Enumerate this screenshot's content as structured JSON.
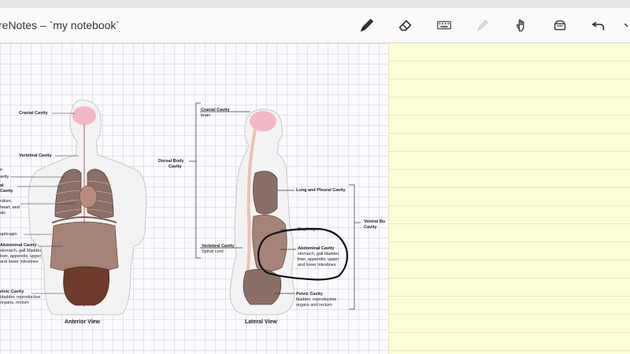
{
  "app": {
    "title": "reNotes – `my notebook`"
  },
  "toolbar": {
    "tools": [
      {
        "name": "pen-icon"
      },
      {
        "name": "eraser-icon"
      },
      {
        "name": "keyboard-icon"
      },
      {
        "name": "highlighter-icon"
      },
      {
        "name": "hand-icon"
      },
      {
        "name": "stack-icon"
      },
      {
        "name": "undo-icon"
      }
    ]
  },
  "figure": {
    "anterior": {
      "caption": "Anterior View",
      "labels": {
        "cranial": "Cranial Cavity",
        "vertebral": "Vertebral Cavity",
        "l1": "e",
        "l2": "avity",
        "l3": "al",
        "l4": "Cavity",
        "l5": "rdium,",
        "l6": "heart, and",
        "l7": "als",
        "diaphragm": "aphragm",
        "abdominal": "Abdominal Cavity",
        "abd_desc1": "stomach, gall bladder,",
        "abd_desc2": "liver, appendix, upper",
        "abd_desc3": "and lower intestines",
        "pelvic": "elvic Cavity",
        "pel_desc1": "bladder, reproductive",
        "pel_desc2": "organs, rectum"
      }
    },
    "lateral": {
      "caption": "Lateral View",
      "labels": {
        "cranial": "Cranial Cavity",
        "cranial_desc": "brain",
        "dorsal": "Dorsal Body",
        "dorsal2": "Cavity",
        "vertebral": "Vertebral Cavity",
        "vertebral_desc": "Spinal cord",
        "lung": "Lung and Pleural Cavity",
        "diaphragm": "Diaphragm",
        "abdominal": "Abdominal Cavity",
        "abd_desc1": "stomach, gall bladder,",
        "abd_desc2": "liver, appendix, upper",
        "abd_desc3": "and lower intestines",
        "pelvic": "Pelvic Cavity",
        "pel_desc1": "bladder, reproductive",
        "pel_desc2": "organs and rectum",
        "ventral": "Ventral Bo",
        "ventral2": "Cavity"
      }
    }
  },
  "colors": {
    "notepad": "#fdfdd6",
    "organ": "#8a6f66",
    "brain": "#f2b8c8",
    "annotation": "#111111"
  }
}
